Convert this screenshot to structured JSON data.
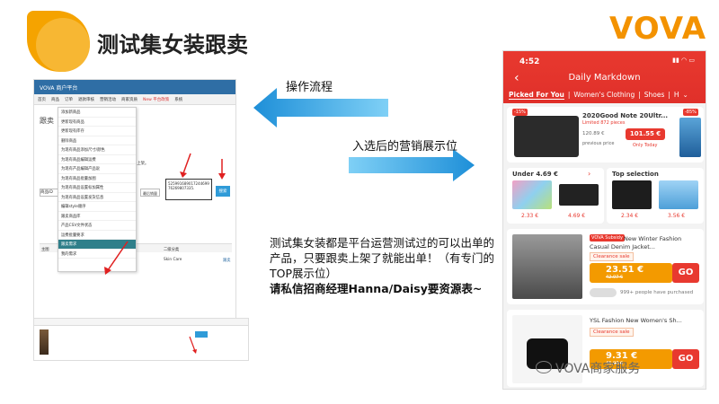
{
  "slide": {
    "title": "测试集女装跟卖",
    "brand": "VOVA",
    "flow_label": "操作流程",
    "showcase_label": "入选后的营销展示位",
    "description": "测试集女装都是平台运营测试过的可以出单的产品，只要跟卖上架了就能出单！（有专门的TOP展示位）",
    "contact": "请私信招商经理Hanna/Daisy要资源表~",
    "watermark": "VOVA商家服务"
  },
  "admin": {
    "top_title": "VOVA 商户平台",
    "nav": [
      "首页",
      "商品",
      "订单",
      "退款审核",
      "营销活动",
      "商家资质",
      "New 平台政策",
      "系统"
    ],
    "page_label": "跟卖",
    "note": "能跟卖的商品已经上架。",
    "menu_items": [
      "添加新商品",
      "更新现有商品",
      "更新现有库存",
      "删除商品",
      "为现有商品添加尺寸/颜色",
      "为现有商品编辑运费",
      "为现有产品编辑产品说",
      "为现有商品批量加图",
      "为现有商品设置标加属性",
      "为现有商品设置发货信息",
      "编辑style顺序",
      "跟卖商品库",
      "产品CSV文件状态",
      "运费批量要求",
      "跟卖需求",
      "我的需求"
    ],
    "select_value": "商品ID",
    "select2_value": "最后销量",
    "textarea_value": "525991689017244699 76269807335.",
    "search_button": "搜索",
    "table_headers": [
      "主图",
      "一级分类",
      "二级分类"
    ],
    "row_category": "Skin Care",
    "row_action": "跟卖"
  },
  "phone": {
    "time": "4:52",
    "title": "Daily Markdown",
    "tabs": [
      "Picked For You",
      "Women's Clothing",
      "Shoes",
      "H"
    ],
    "hero": {
      "discount_badge": "-15%",
      "product_title": "2020Good Note 20Ultr...",
      "limited": "Limited 872 pieces",
      "old_price": "120.89 €",
      "price": "101.55 €",
      "only_today": "Only Today",
      "previous_label": "previous price",
      "right_badge": "-85%"
    },
    "under_panel": {
      "title": "Under 4.69 €",
      "prices": [
        "2.33 €",
        "4.69 €"
      ]
    },
    "top_panel": {
      "title": "Top selection",
      "prices": [
        "2.34 €",
        "3.56 €"
      ]
    },
    "product1": {
      "title": "New Winter Fashion Casual Denim Jacket...",
      "subsidy": "VOVA Subsidy",
      "tag": "Clearance sale",
      "price": "23.51 €",
      "old_price": "42.07 €",
      "go": "GO",
      "people": "999+ people have purchased"
    },
    "product2": {
      "title": "YSL Fashion New Women's Sh...",
      "tag": "Clearance sale",
      "price": "9.31 €",
      "old_price": "46.07 €",
      "go": "GO"
    }
  }
}
